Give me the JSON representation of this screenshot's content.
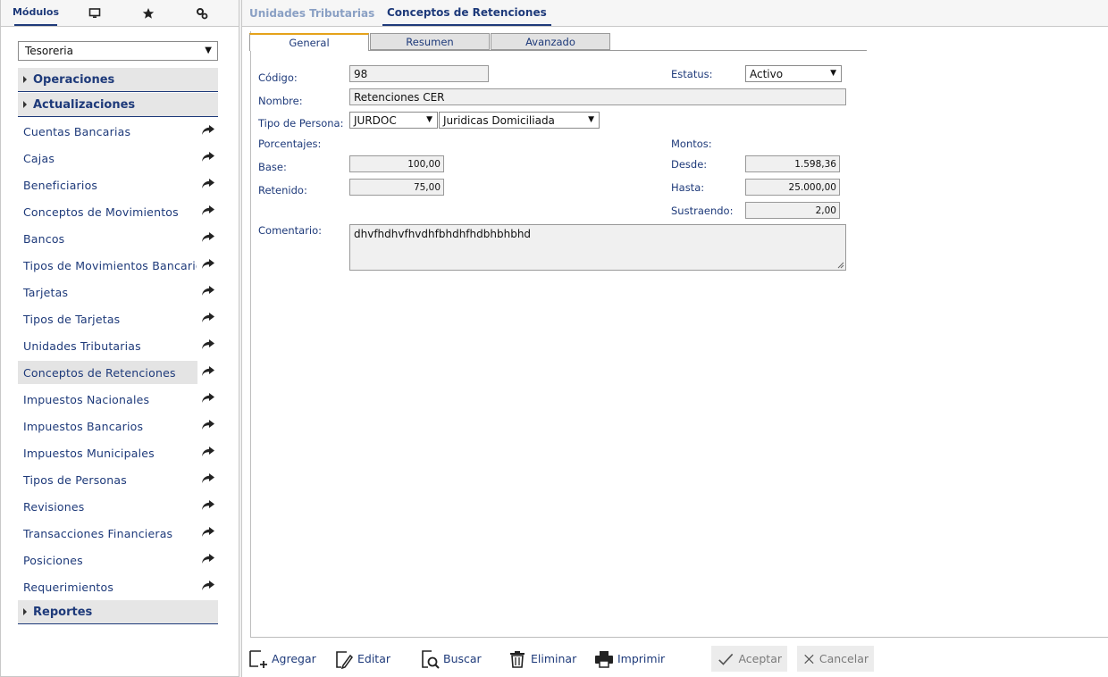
{
  "sidebar": {
    "tabs": [
      {
        "label": "Módulos",
        "icon": ""
      },
      {
        "label": "",
        "icon": "monitor-icon"
      },
      {
        "label": "",
        "icon": "star-icon"
      },
      {
        "label": "",
        "icon": "settings-icon"
      }
    ],
    "module_select": "Tesoreria",
    "sections": {
      "operaciones": "Operaciones",
      "actualizaciones": "Actualizaciones",
      "reportes": "Reportes"
    },
    "items": [
      "Cuentas Bancarias",
      "Cajas",
      "Beneficiarios",
      "Conceptos de Movimientos",
      "Bancos",
      "Tipos de Movimientos Bancarios",
      "Tarjetas",
      "Tipos de Tarjetas",
      "Unidades Tributarias",
      "Conceptos de Retenciones",
      "Impuestos Nacionales",
      "Impuestos Bancarios",
      "Impuestos Municipales",
      "Tipos de Personas",
      "Revisiones",
      "Transacciones Financieras",
      "Posiciones",
      "Requerimientos"
    ],
    "active_item": "Conceptos de Retenciones"
  },
  "top_tabs": [
    "Unidades Tributarias",
    "Conceptos de Retenciones"
  ],
  "sub_tabs": [
    "General",
    "Resumen",
    "Avanzado"
  ],
  "form": {
    "codigo_label": "Código:",
    "codigo": "98",
    "estatus_label": "Estatus:",
    "estatus": "Activo",
    "nombre_label": "Nombre:",
    "nombre": "Retenciones CER",
    "tipo_label": "Tipo de Persona:",
    "tipo_code": "JURDOC",
    "tipo_desc": "Juridicas Domiciliada",
    "porcentajes_label": "Porcentajes:",
    "montos_label": "Montos:",
    "base_label": "Base:",
    "base": "100,00",
    "retenido_label": "Retenido:",
    "retenido": "75,00",
    "desde_label": "Desde:",
    "desde": "1.598,36",
    "hasta_label": "Hasta:",
    "hasta": "25.000,00",
    "sustraendo_label": "Sustraendo:",
    "sustraendo": "2,00",
    "comentario_label": "Comentario:",
    "comentario": "dhvfhdhvfhvdhfbhdhfhdbhbhbhd"
  },
  "toolbar": {
    "agregar": "Agregar",
    "editar": "Editar",
    "buscar": "Buscar",
    "eliminar": "Eliminar",
    "imprimir": "Imprimir",
    "aceptar": "Aceptar",
    "cancelar": "Cancelar"
  },
  "colors": {
    "accent": "#1e3a7a",
    "tab_highlight": "#e5a21a"
  }
}
